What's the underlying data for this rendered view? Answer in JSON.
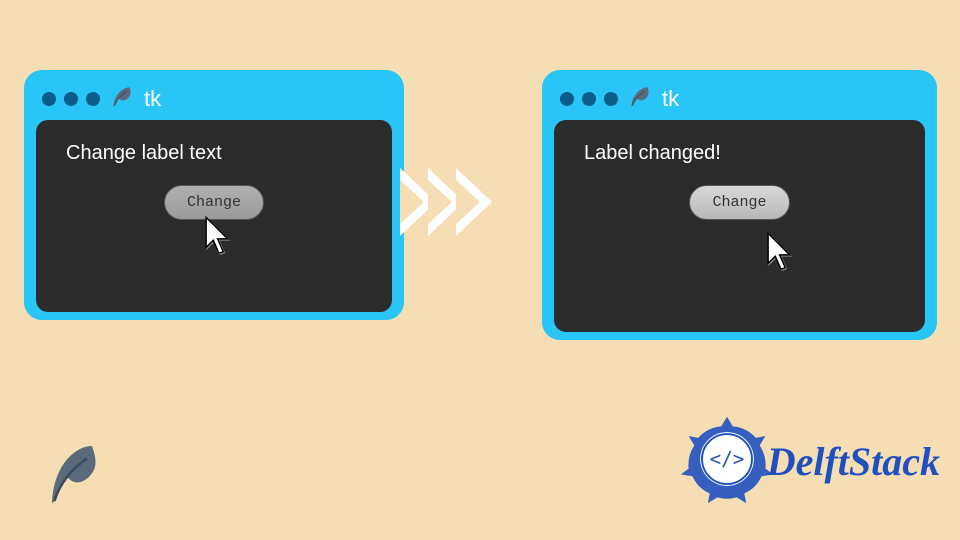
{
  "windows": {
    "left": {
      "title": "tk",
      "label": "Change label text",
      "button": "Change"
    },
    "right": {
      "title": "tk",
      "label": "Label changed!",
      "button": "Change"
    }
  },
  "brand": {
    "name": "DelftStack"
  },
  "icons": {
    "feather": "feather-icon",
    "cursor": "cursor-icon",
    "chevron": "chevron-right-icon",
    "traffic_dot": "window-dot-icon"
  },
  "colors": {
    "bg": "#f5deb3",
    "window_frame": "#29c5f6",
    "content_bg": "#2b2b2b",
    "brand": "#2050c0"
  }
}
